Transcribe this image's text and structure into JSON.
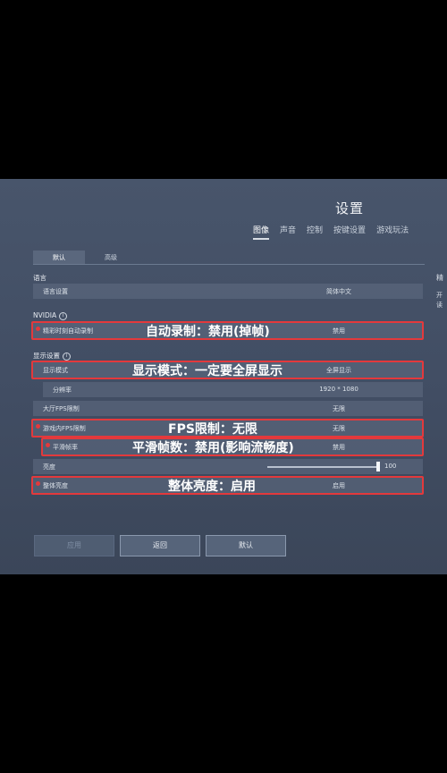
{
  "window": {
    "title": "设置"
  },
  "main_tabs": [
    {
      "label": "图像",
      "active": true
    },
    {
      "label": "声音",
      "active": false
    },
    {
      "label": "控制",
      "active": false
    },
    {
      "label": "按键设置",
      "active": false
    },
    {
      "label": "游戏玩法",
      "active": false
    }
  ],
  "sub_tabs": [
    {
      "label": "默认",
      "active": true
    },
    {
      "label": "高级",
      "active": false
    }
  ],
  "language": {
    "header": "语言",
    "row_label": "语言设置",
    "row_value": "简体中文"
  },
  "nvidia": {
    "header": "NVIDIA",
    "row_label": "精彩时刻自动录制",
    "row_value": "禁用",
    "annotation": "自动录制：禁用(掉帧)"
  },
  "display": {
    "header": "显示设置",
    "mode_label": "显示模式",
    "mode_value": "全屏显示",
    "mode_annotation": "显示模式：一定要全屏显示",
    "resolution_label": "分辨率",
    "resolution_value": "1920 * 1080",
    "lobby_fps_label": "大厅FPS限制",
    "lobby_fps_value": "无限",
    "ingame_fps_label": "游戏内FPS限制",
    "ingame_fps_value": "无限",
    "ingame_fps_annotation": "FPS限制：无限",
    "smooth_label": "平滑帧率",
    "smooth_value": "禁用",
    "smooth_annotation": "平滑帧数：禁用(影响流畅度)",
    "brightness_label": "亮度",
    "brightness_value": "100",
    "brightness_level": 1.0,
    "overall_brightness_label": "整体亮度",
    "overall_brightness_value": "启用",
    "overall_brightness_annotation": "整体亮度：启用"
  },
  "buttons": {
    "apply": "应用",
    "back": "返回",
    "default": "默认"
  },
  "side_panel": {
    "title_fragment": "精",
    "line1": "开",
    "line2": "读"
  },
  "colors": {
    "highlight_red": "#e3393c",
    "panel_bg": "#48556b"
  }
}
